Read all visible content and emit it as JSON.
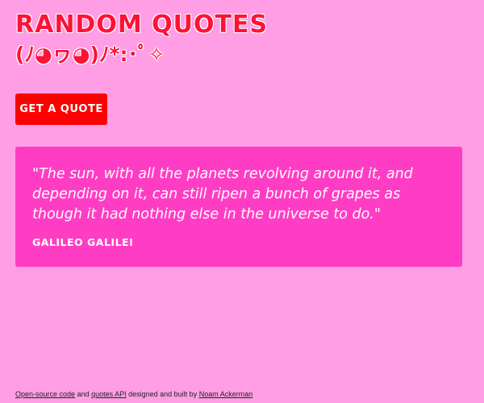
{
  "header": {
    "title": "RANDOM QUOTES",
    "kaomoji": "(ﾉ◕ヮ◕)ﾉ*:･ﾟ✧"
  },
  "button": {
    "label": "GET A QUOTE"
  },
  "quote": {
    "text": "\"The sun, with all the planets revolving around it, and depending on it, can still ripen a bunch of grapes as though it had nothing else in the universe to do.\"",
    "author": "GALILEO GALILEI"
  },
  "footer": {
    "source_link": "Open-source code",
    "and": " and ",
    "api_link": "quotes API",
    "middle": " designed and built by ",
    "author_link": "Noam Ackerman"
  },
  "colors": {
    "background": "#ff9ee5",
    "title": "#ff1236",
    "button": "#ff0000",
    "card": "#ff3dc4"
  }
}
